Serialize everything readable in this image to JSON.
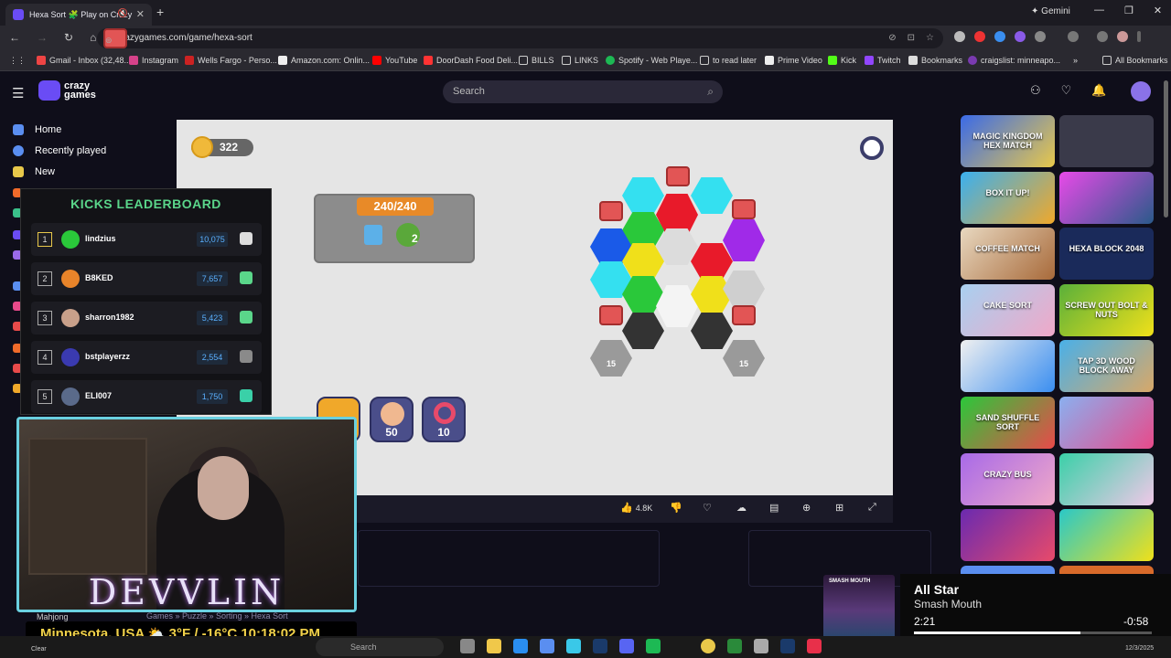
{
  "browser": {
    "tab_title": "Hexa Sort 🧩 Play on Crazy",
    "gemini": "Gemini",
    "url": "crazygames.com/game/hexa-sort",
    "bookmarks": [
      "Gmail - Inbox (32,48...",
      "Instagram",
      "Wells Fargo - Perso...",
      "Amazon.com: Onlin...",
      "YouTube",
      "DoorDash Food Deli...",
      "BILLS",
      "LINKS",
      "Spotify - Web Playe...",
      "to read later",
      "Prime Video",
      "Kick",
      "Twitch",
      "Bookmarks",
      "craigslist: minneapo...",
      "All Bookmarks"
    ]
  },
  "site": {
    "logo_line1": "crazy",
    "logo_line2": "games",
    "search_placeholder": "Search",
    "sidebar": [
      "Home",
      "Recently played",
      "New"
    ]
  },
  "game": {
    "coins": "322",
    "goal_count": "240/240",
    "goal_num": "2",
    "powerup_costs": [
      "50",
      "10"
    ],
    "slot_coins": [
      "15",
      "15"
    ]
  },
  "action_bar": {
    "likes": "4.8K"
  },
  "thumbnails": [
    "MAGIC KINGDOM HEX MATCH",
    "",
    "BOX IT UP!",
    "",
    "COFFEE MATCH",
    "HEXA BLOCK 2048",
    "CAKE SORT",
    "SCREW OUT BOLT & NUTS",
    "",
    "TAP 3D WOOD BLOCK AWAY",
    "SAND SHUFFLE SORT",
    "",
    "CRAZY BUS",
    "",
    "",
    ""
  ],
  "leaderboard": {
    "title": "KICKS LEADERBOARD",
    "rows": [
      {
        "rank": "1",
        "name": "lindzius",
        "score": "10,075"
      },
      {
        "rank": "2",
        "name": "B8KED",
        "score": "7,657"
      },
      {
        "rank": "3",
        "name": "sharron1982",
        "score": "5,423"
      },
      {
        "rank": "4",
        "name": "bstplayerzz",
        "score": "2,554"
      },
      {
        "rank": "5",
        "name": "ELI007",
        "score": "1,750"
      }
    ]
  },
  "stream": {
    "name": "DEVVLIN",
    "location": "Minnesota, USA",
    "weather": "3°F / -16°C 10:18:02 PM",
    "crumbs": "Games » Puzzle » Sorting » Hexa Sort",
    "mahjong": "Mahjong"
  },
  "music": {
    "song": "All Star",
    "artist": "Smash Mouth",
    "album_text": "SMASH MOUTH",
    "elapsed": "2:21",
    "remaining": "-0:58",
    "progress": 0.7
  },
  "taskbar": {
    "search": "Search",
    "date": "12/3/2025",
    "weather_label": "Clear"
  },
  "colors": {
    "accent": "#6a4cf5",
    "leaderboard_green": "#5ad68a"
  }
}
